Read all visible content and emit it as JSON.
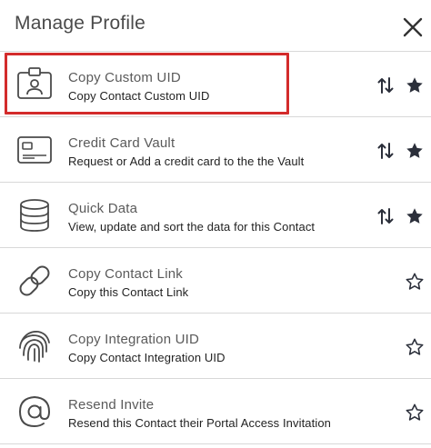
{
  "header": {
    "title": "Manage Profile",
    "close_icon": "close-icon"
  },
  "items": [
    {
      "title": "Copy Custom UID",
      "subtitle": "Copy Contact Custom UID",
      "icon": "id-badge-icon",
      "sortable": true,
      "starred": true
    },
    {
      "title": "Credit Card Vault",
      "subtitle": "Request or Add a credit card to the the Vault",
      "icon": "credit-card-icon",
      "sortable": true,
      "starred": true
    },
    {
      "title": "Quick Data",
      "subtitle": "View, update and sort the data for this Contact",
      "icon": "database-icon",
      "sortable": true,
      "starred": true
    },
    {
      "title": "Copy Contact Link",
      "subtitle": "Copy this Contact Link",
      "icon": "link-icon",
      "sortable": false,
      "starred": false
    },
    {
      "title": "Copy Integration UID",
      "subtitle": "Copy Contact Integration UID",
      "icon": "fingerprint-icon",
      "sortable": false,
      "starred": false
    },
    {
      "title": "Resend Invite",
      "subtitle": "Resend this Contact their Portal Access Invitation",
      "icon": "at-sign-icon",
      "sortable": false,
      "starred": false
    }
  ],
  "colors": {
    "highlight": "#d32b2b",
    "icon": "#4a4a4a",
    "star": "#2b2f3a"
  }
}
